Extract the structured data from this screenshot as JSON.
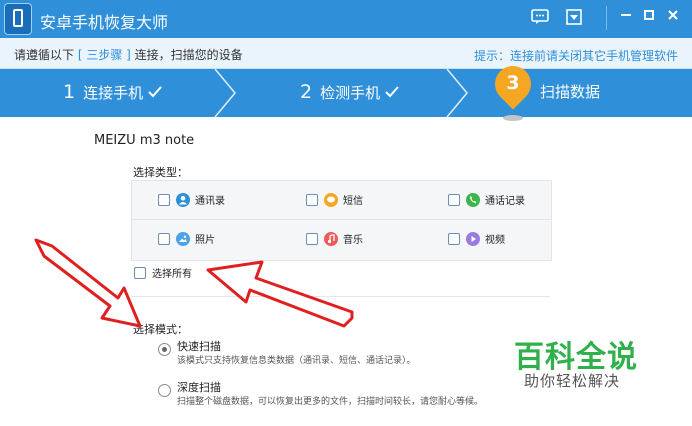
{
  "window": {
    "title": "安卓手机恢复大师",
    "controls": [
      "message-icon",
      "dropdown-icon",
      "minimize-icon",
      "maximize-icon",
      "close-icon"
    ]
  },
  "infobar": {
    "prefix": "请遵循以下",
    "steps_link": "[ 三步骤 ]",
    "suffix": "连接，扫描您的设备",
    "tip": "提示：连接前请关闭其它手机管理软件"
  },
  "steps": [
    {
      "num": "1",
      "label": "连接手机",
      "done": true
    },
    {
      "num": "2",
      "label": "检测手机",
      "done": true
    },
    {
      "num": "3",
      "label": "扫描数据",
      "active": true
    }
  ],
  "device_name": "MEIZU m3 note",
  "types": {
    "label": "选择类型：",
    "items": [
      {
        "label": "通讯录",
        "icon": "contacts-icon",
        "color": "#2f8fd9"
      },
      {
        "label": "短信",
        "icon": "sms-icon",
        "color": "#f5a623"
      },
      {
        "label": "通话记录",
        "icon": "phone-icon",
        "color": "#3cb54a"
      },
      {
        "label": "照片",
        "icon": "photo-icon",
        "color": "#4ca3e6"
      },
      {
        "label": "音乐",
        "icon": "music-icon",
        "color": "#ef5a5a"
      },
      {
        "label": "视频",
        "icon": "video-icon",
        "color": "#9a7ce0"
      }
    ],
    "select_all": "选择所有"
  },
  "modes": {
    "label": "选择模式：",
    "quick_title": "快速扫描",
    "quick_desc": "该模式只支持恢复信息类数据（通讯录、短信、通话记录）。",
    "deep_title": "深度扫描",
    "deep_desc": "扫描整个磁盘数据，可以恢复出更多的文件，扫描时间较长，请您耐心等候。",
    "selected": "quick"
  },
  "watermark": {
    "title": "百科全说",
    "subtitle": "助你轻松解决"
  },
  "colors": {
    "primary": "#2f8fd9",
    "accent": "#f5a623",
    "annotation": "#e02020",
    "watermark": "#2fb04a"
  }
}
